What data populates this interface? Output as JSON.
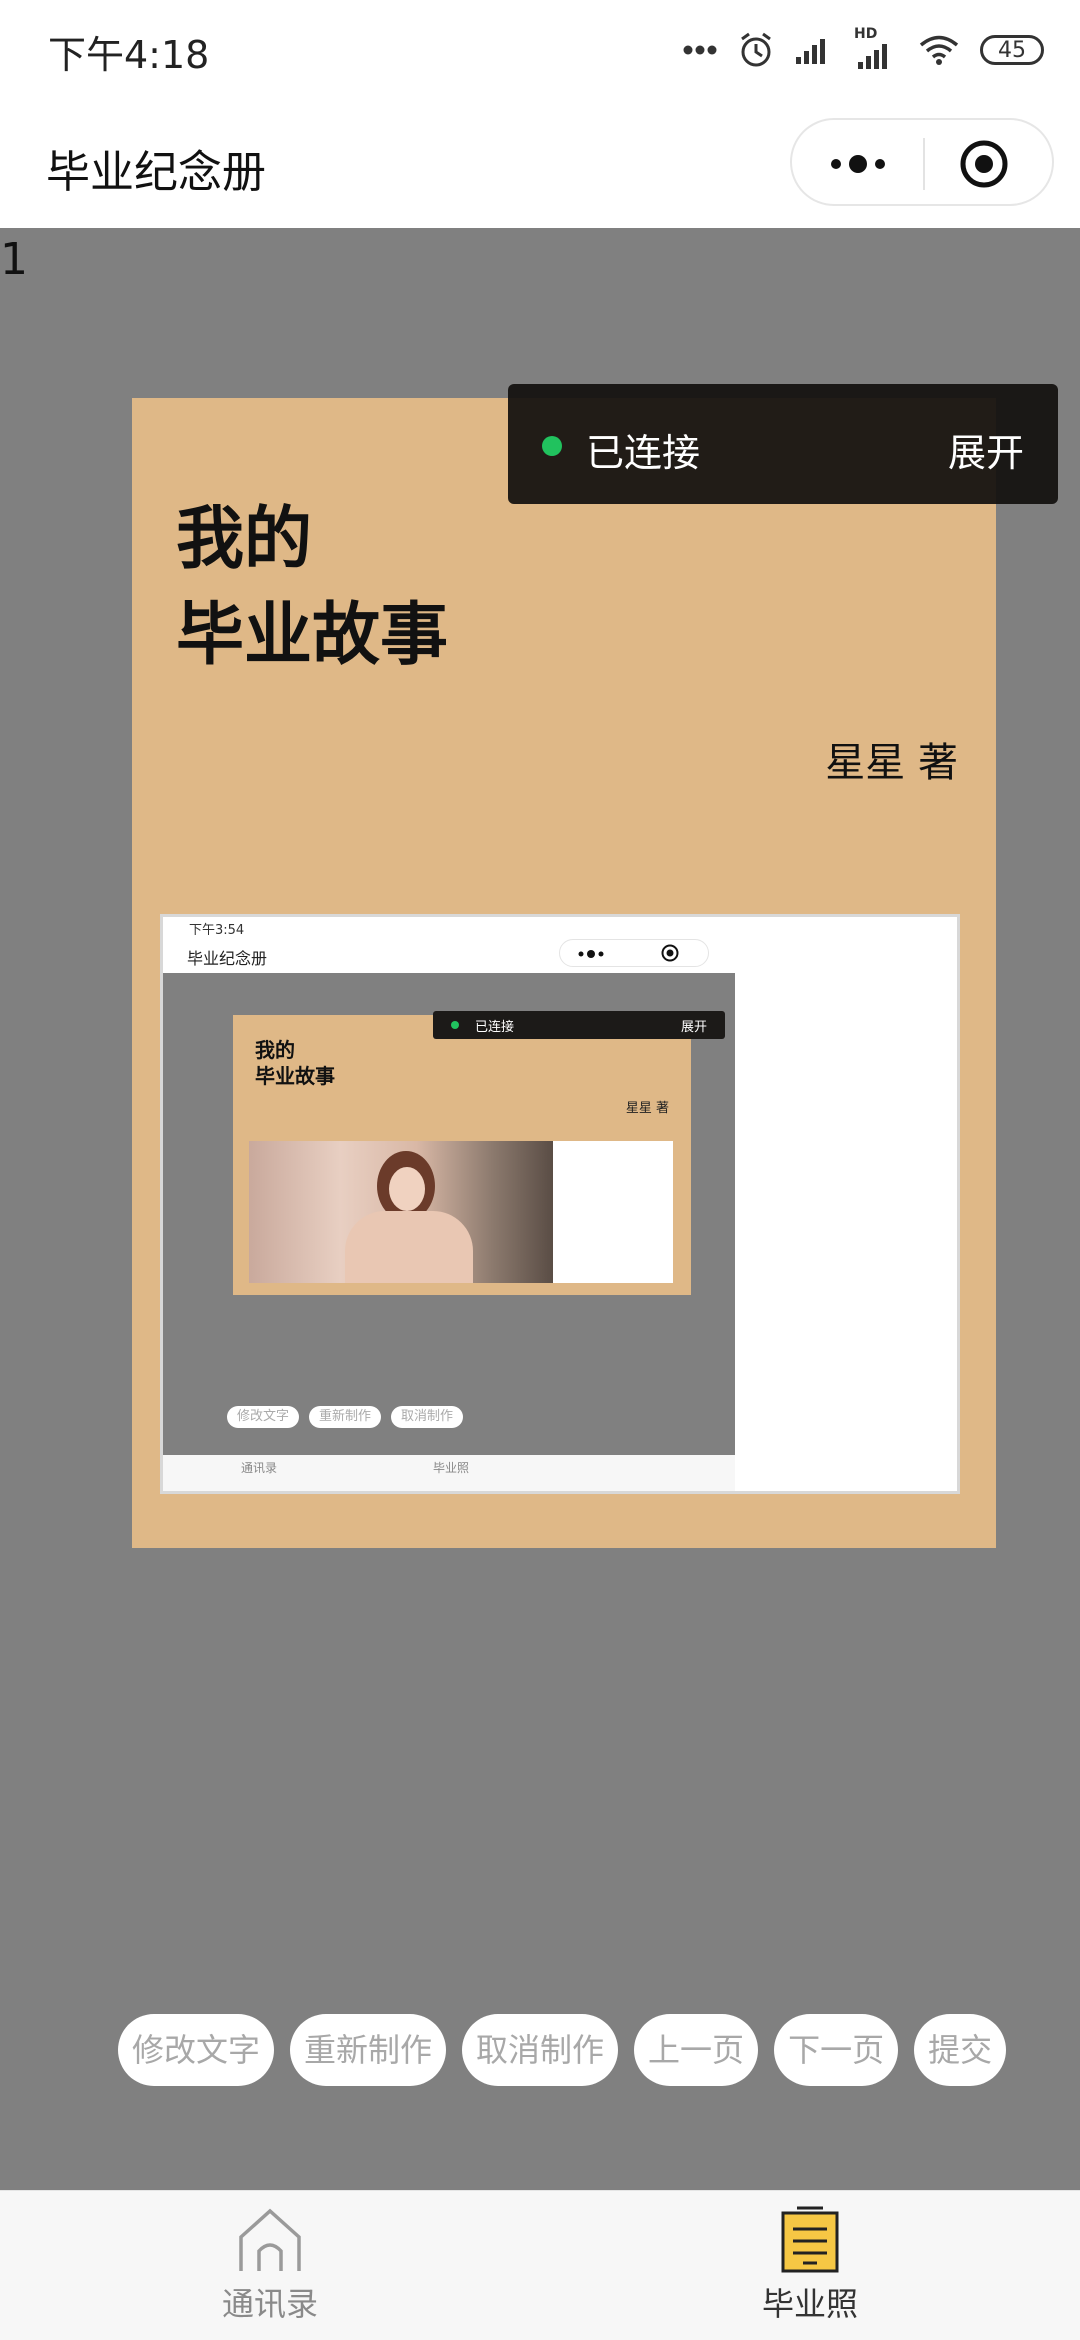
{
  "status_bar": {
    "time": "下午4:18",
    "battery": "45",
    "network_badge": "HD"
  },
  "nav": {
    "title": "毕业纪念册"
  },
  "page_number": "1",
  "book": {
    "title_line1": "我的",
    "title_line2": "毕业故事",
    "author": "星星 著"
  },
  "toast": {
    "status": "已连接",
    "expand": "展开"
  },
  "mini": {
    "time": "下午3:54",
    "title": "毕业纪念册",
    "book_title_line1": "我的",
    "book_title_line2": "毕业故事",
    "author": "星星 著",
    "toast_status": "已连接",
    "toast_expand": "展开",
    "actions": [
      "修改文字",
      "重新制作",
      "取消制作"
    ],
    "tabs": [
      "通讯录",
      "毕业照"
    ]
  },
  "actions": [
    "修改文字",
    "重新制作",
    "取消制作",
    "上一页",
    "下一页",
    "提交"
  ],
  "tabbar": {
    "items": [
      {
        "label": "通讯录",
        "icon": "house-icon",
        "active": false
      },
      {
        "label": "毕业照",
        "icon": "document-icon",
        "active": true
      }
    ],
    "active_color": "#f6c744"
  },
  "colors": {
    "book_bg": "#dfb887",
    "canvas_bg": "#808080",
    "connected_dot": "#21c25e"
  }
}
